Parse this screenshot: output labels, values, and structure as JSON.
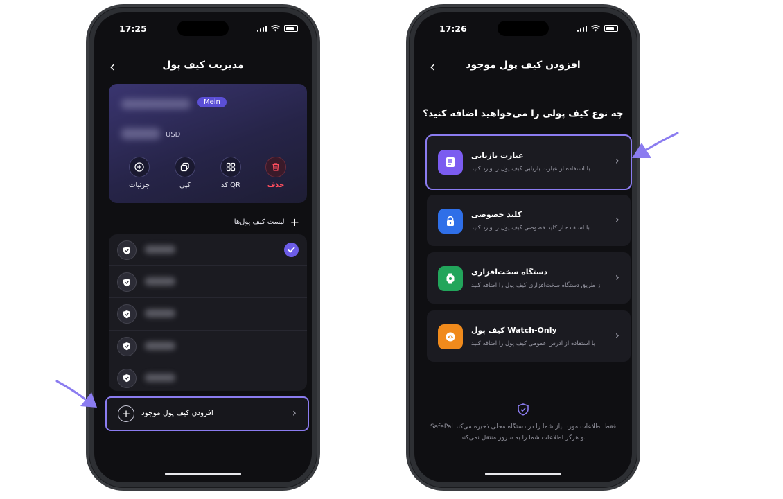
{
  "phone1": {
    "status_time": "17:25",
    "title": "مدیریت کیف پول",
    "card": {
      "main_badge": "Mein",
      "currency": "USD",
      "actions": [
        {
          "label": "جزئیات",
          "icon": "info-plus-icon"
        },
        {
          "label": "کپی",
          "icon": "copy-icon"
        },
        {
          "label": "کد QR",
          "icon": "qr-grid-icon"
        },
        {
          "label": "حذف",
          "icon": "trash-icon"
        }
      ]
    },
    "list_header": "لیست کیف پول‌ها",
    "add_existing": "افزودن کیف پول موجود"
  },
  "phone2": {
    "status_time": "17:26",
    "title": "افزودن کیف پول موجود",
    "question": "چه نوع کیف پولی را می‌خواهید اضافه کنید؟",
    "options": [
      {
        "title": "عبارت بازیابی",
        "desc": "با استفاده از عبارت بازیابی کیف پول را وارد کنید",
        "color": "#7b5cf0",
        "icon": "document-icon"
      },
      {
        "title": "کلید خصوصی",
        "desc": "با استفاده از کلید خصوصی کیف پول را وارد کنید",
        "color": "#2f6fe8",
        "icon": "lock-icon"
      },
      {
        "title": "دستگاه سخت‌افزاری",
        "desc": "از طریق دستگاه سخت‌افزاری کیف پول را اضافه کنید",
        "color": "#22a55b",
        "icon": "hardware-watch-icon"
      },
      {
        "title": "کیف پول Watch-Only",
        "desc": "با استفاده از آدرس عمومی کیف پول را اضافه کنید",
        "color": "#f08a1c",
        "icon": "eye-icon"
      }
    ],
    "footer": "SafePal فقط اطلاعات مورد نیاز شما را در دستگاه محلی ذخیره می‌کند و هرگز اطلاعات شما را به سرور منتقل نمی‌کند."
  },
  "colors": {
    "accent": "#8b7cf0",
    "danger": "#ff4e5e",
    "screen_bg": "#0f0f12"
  }
}
